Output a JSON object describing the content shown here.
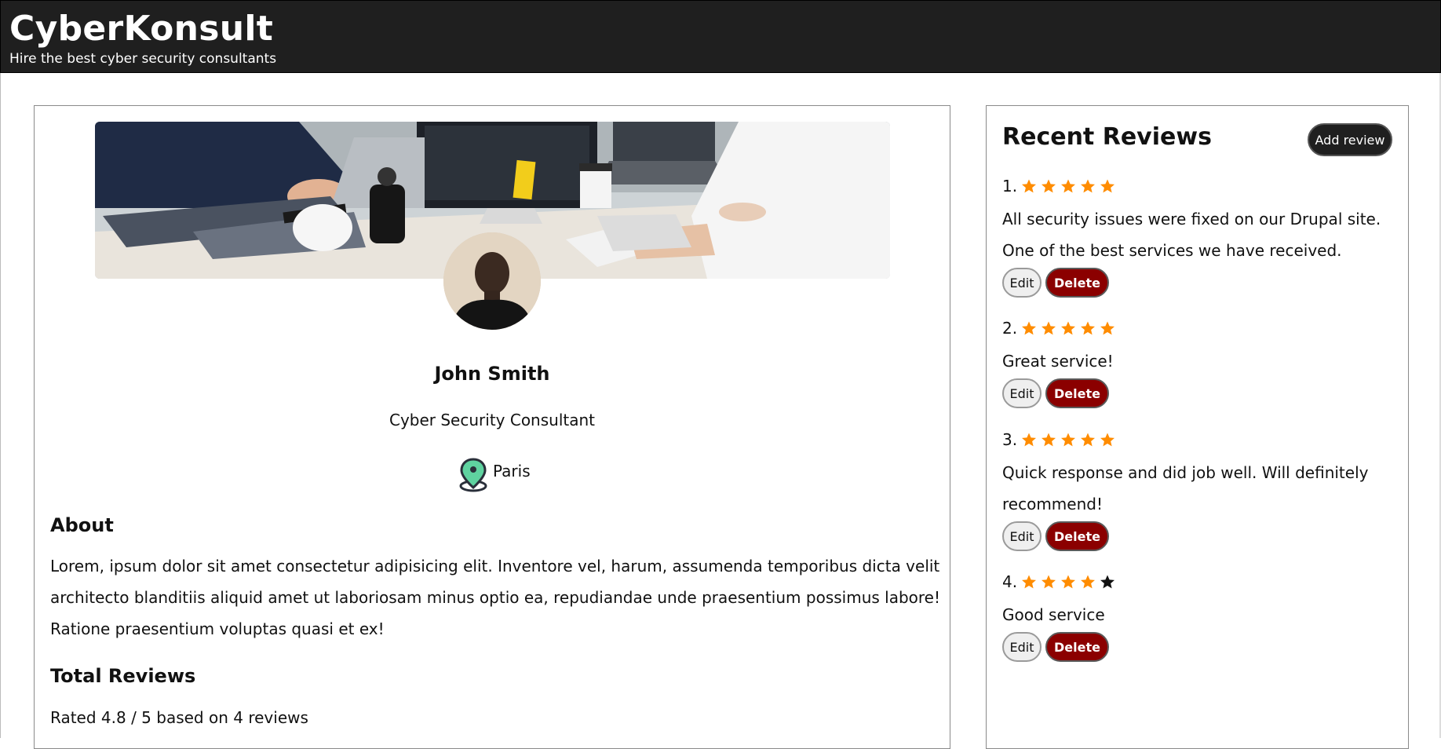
{
  "header": {
    "title": "CyberKonsult",
    "subtitle": "Hire the best cyber security consultants"
  },
  "profile": {
    "name": "John Smith",
    "role": "Cyber Security Consultant",
    "location": "Paris",
    "about_heading": "About",
    "about_text": "Lorem, ipsum dolor sit amet consectetur adipisicing elit. Inventore vel, harum, assumenda temporibus dicta velit architecto blanditiis aliquid amet ut laboriosam minus optio ea, repudiandae unde praesentium possimus labore! Ratione praesentium voluptas quasi et ex!",
    "total_reviews_heading": "Total Reviews",
    "rating_summary": "Rated 4.8 / 5 based on 4 reviews",
    "icons": {
      "location": "map-pin-icon"
    }
  },
  "reviews": {
    "title": "Recent Reviews",
    "add_label": "Add review",
    "edit_label": "Edit",
    "delete_label": "Delete",
    "items": [
      {
        "number": "1.",
        "rating": 5,
        "text": "All security issues were fixed on our Drupal site. One of the best services we have received."
      },
      {
        "number": "2.",
        "rating": 5,
        "text": "Great service!"
      },
      {
        "number": "3.",
        "rating": 5,
        "text": "Quick response and did job well. Will definitely recommend!"
      },
      {
        "number": "4.",
        "rating": 4,
        "text": "Good service"
      }
    ]
  },
  "colors": {
    "header_bg": "#1f1f1f",
    "star_filled": "#ff8c00",
    "star_empty": "#111111",
    "delete_button": "#8b0000",
    "location_pin": "#5fd3a0"
  }
}
